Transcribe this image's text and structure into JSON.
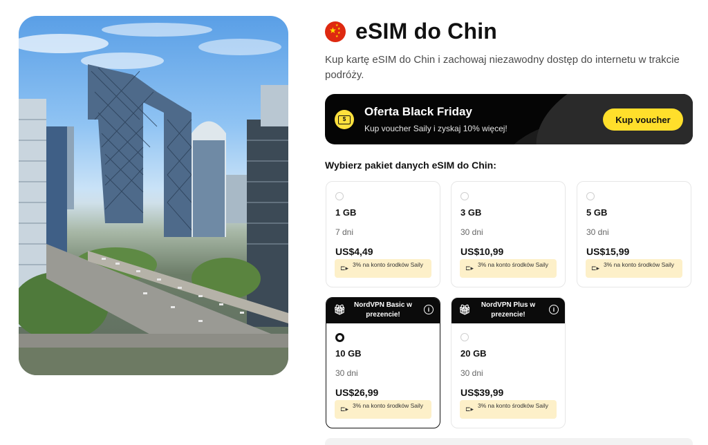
{
  "page": {
    "title": "eSIM do Chin",
    "subtitle": "Kup kartę eSIM do Chin i zachowaj niezawodny dostęp do internetu w trakcie podróży.",
    "flag_icon": "china-flag-icon"
  },
  "promo": {
    "title": "Oferta Black Friday",
    "text": "Kup voucher Saily i zyskaj 10% więcej!",
    "button_label": "Kup voucher",
    "icon": "ticket-icon",
    "accent": "#ffdf2b",
    "background": "#050505"
  },
  "plans_section": {
    "label": "Wybierz pakiet danych eSIM do Chin:"
  },
  "plans": [
    {
      "data": "1 GB",
      "duration": "7 dni",
      "price": "US$4,49",
      "cashback": "3% na konto środków Saily",
      "selected": false,
      "gift": ""
    },
    {
      "data": "3 GB",
      "duration": "30 dni",
      "price": "US$10,99",
      "cashback": "3% na konto środków Saily",
      "selected": false,
      "gift": ""
    },
    {
      "data": "5 GB",
      "duration": "30 dni",
      "price": "US$15,99",
      "cashback": "3% na konto środków Saily",
      "selected": false,
      "gift": ""
    },
    {
      "data": "10 GB",
      "duration": "30 dni",
      "price": "US$26,99",
      "cashback": "3% na konto środków Saily",
      "selected": true,
      "gift": "NordVPN Basic w prezencie!"
    },
    {
      "data": "20 GB",
      "duration": "30 dni",
      "price": "US$39,99",
      "cashback": "3% na konto środków Saily",
      "selected": false,
      "gift": "NordVPN Plus w prezencie!"
    }
  ],
  "colors": {
    "flag_red": "#de2910",
    "cashback_bg": "#fdf0c9"
  }
}
